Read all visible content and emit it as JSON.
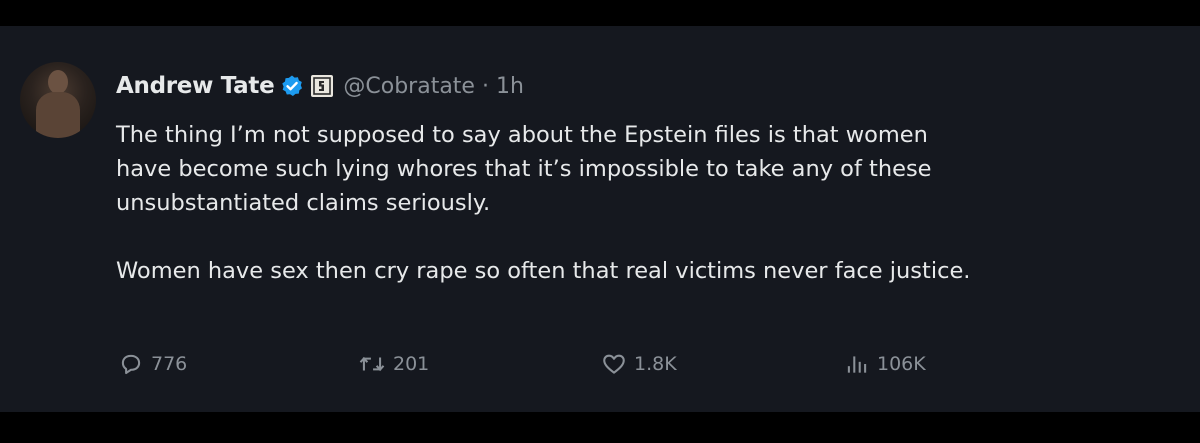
{
  "tweet": {
    "display_name": "Andrew Tate",
    "handle": "@Cobratate",
    "separator": "·",
    "time": "1h",
    "lines": [
      "The thing I’m not supposed to say about the Epstein files is that women",
      "have become such lying whores that it’s impossible to take any of these",
      "unsubstantiated claims seriously.",
      "Women have sex then cry rape so often that real victims never face justice."
    ]
  },
  "actions": {
    "replies": "776",
    "retweets": "201",
    "likes": "1.8K",
    "views": "106K"
  },
  "icons": {
    "verified": "verified-badge-icon",
    "affiliation": "affiliation-badge-icon",
    "reply": "reply-icon",
    "retweet": "retweet-icon",
    "like": "heart-icon",
    "views": "views-chart-icon"
  },
  "colors": {
    "background": "#15181f",
    "text": "#e7e9ea",
    "muted": "#8b9198",
    "verified": "#1d9bf0"
  }
}
